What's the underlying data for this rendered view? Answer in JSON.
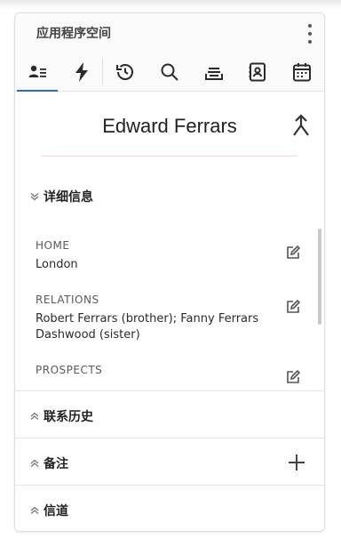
{
  "app": {
    "title": "应用程序空间"
  },
  "tabs": [
    {
      "icon": "contact-card-icon",
      "active": true
    },
    {
      "icon": "lightning-icon",
      "active": false
    },
    {
      "icon": "history-icon",
      "active": false
    },
    {
      "icon": "search-icon",
      "active": false
    },
    {
      "icon": "stack-icon",
      "active": false
    },
    {
      "icon": "address-book-icon",
      "active": false
    },
    {
      "icon": "calendar-icon",
      "active": false
    }
  ],
  "contact": {
    "name": "Edward Ferrars"
  },
  "details": {
    "title": "详细信息",
    "fields": [
      {
        "label": "HOME",
        "value": "London"
      },
      {
        "label": "RELATIONS",
        "value": "Robert Ferrars (brother); Fanny Ferrars Dashwood (sister)"
      },
      {
        "label": "PROSPECTS",
        "value": ""
      }
    ]
  },
  "sections": {
    "history": "联系历史",
    "notes": "备注",
    "channels": "信道"
  },
  "colors": {
    "accent": "#2b6cd4",
    "divider": "#f1d9d9"
  }
}
